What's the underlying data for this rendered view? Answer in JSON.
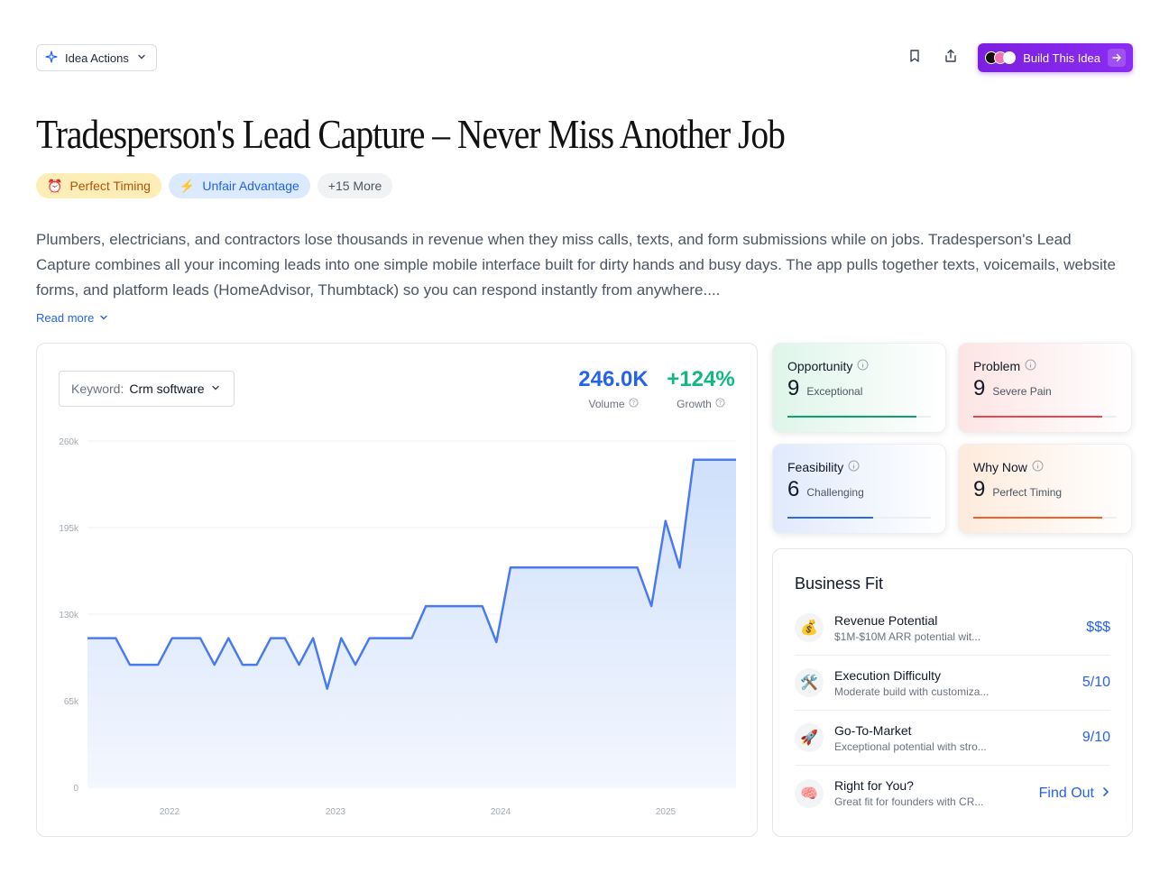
{
  "header": {
    "idea_actions_label": "Idea Actions",
    "build_label": "Build This Idea"
  },
  "title": "Tradesperson's Lead Capture – Never Miss Another Job",
  "tags": [
    {
      "icon": "alarm-clock-icon",
      "glyph": "⏰",
      "label": "Perfect Timing"
    },
    {
      "icon": "lightning-icon",
      "glyph": "⚡",
      "label": "Unfair Advantage"
    },
    {
      "label": "+15 More"
    }
  ],
  "description": "Plumbers, electricians, and contractors lose thousands in revenue when they miss calls, texts, and form submissions while on jobs. Tradesperson's Lead Capture combines all your incoming leads into one simple mobile interface built for dirty hands and busy days. The app pulls together texts, voicemails, website forms, and platform leads (HomeAdvisor, Thumbtack) so you can respond instantly from anywhere....",
  "read_more": "Read more",
  "keyword": {
    "label": "Keyword:",
    "value": "Crm software"
  },
  "stats": {
    "volume_value": "246.0K",
    "volume_label": "Volume",
    "growth_value": "+124%",
    "growth_label": "Growth"
  },
  "chart_data": {
    "type": "area",
    "series": [
      {
        "values": [
          112000,
          112000,
          112000,
          92000,
          92000,
          92000,
          112000,
          112000,
          112000,
          92000,
          112000,
          92000,
          92000,
          112000,
          112000,
          92000,
          112000,
          74000,
          112000,
          92000,
          112000,
          112000,
          112000,
          112000,
          136000,
          136000,
          136000,
          136000,
          136000,
          109000,
          165000,
          165000,
          165000,
          165000,
          165000,
          165000,
          165000,
          165000,
          165000,
          165000,
          136000,
          200000,
          165000,
          246000,
          246000,
          246000,
          246000
        ]
      }
    ],
    "x_ticks": [
      "2022",
      "2023",
      "2024",
      "2025"
    ],
    "y_ticks": [
      "0",
      "65k",
      "130k",
      "195k",
      "260k"
    ],
    "ylim": [
      0,
      260000
    ],
    "grid": true,
    "colors": {
      "line": "#4a7af0",
      "fill_top": "#cfe0fb",
      "fill_bottom": "#f3f7fe"
    }
  },
  "scores": [
    {
      "name": "Opportunity",
      "value": "9",
      "desc": "Exceptional",
      "fill": 0.9,
      "color": "#10a06a"
    },
    {
      "name": "Problem",
      "value": "9",
      "desc": "Severe Pain",
      "fill": 0.9,
      "color": "#e5484d"
    },
    {
      "name": "Feasibility",
      "value": "6",
      "desc": "Challenging",
      "fill": 0.6,
      "color": "#2d6ae3"
    },
    {
      "name": "Why Now",
      "value": "9",
      "desc": "Perfect Timing",
      "fill": 0.9,
      "color": "#f0622a"
    }
  ],
  "business_fit": {
    "title": "Business Fit",
    "items": [
      {
        "icon": "money-bag-icon",
        "glyph": "💰",
        "name": "Revenue Potential",
        "sub": "$1M-$10M ARR potential wit...",
        "value": "$$$"
      },
      {
        "icon": "tools-icon",
        "glyph": "🛠️",
        "name": "Execution Difficulty",
        "sub": "Moderate build with customiza...",
        "value": "5/10"
      },
      {
        "icon": "rocket-icon",
        "glyph": "🚀",
        "name": "Go-To-Market",
        "sub": "Exceptional potential with stro...",
        "value": "9/10"
      },
      {
        "icon": "brain-icon",
        "glyph": "🧠",
        "name": "Right for You?",
        "sub": "Great fit for founders with CR...",
        "value": "Find Out"
      }
    ]
  }
}
